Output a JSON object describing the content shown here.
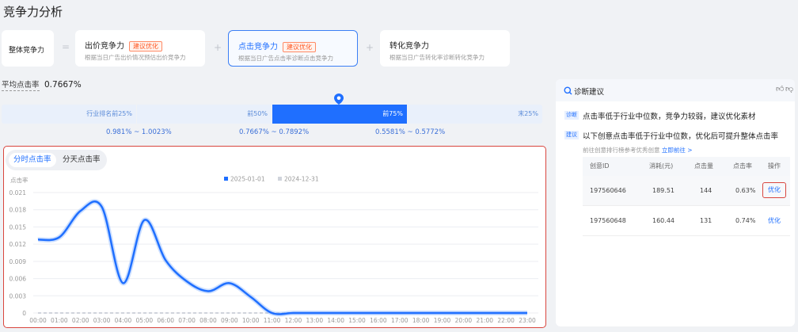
{
  "page_title": "竞争力分析",
  "overall": {
    "label": "整体竞争力"
  },
  "cards": [
    {
      "title": "出价竞争力",
      "tag": "建议优化",
      "desc": "根据当日广告出价情况预估出价竞争力"
    },
    {
      "title": "点击竞争力",
      "tag": "建议优化",
      "desc": "根据当日广告点击率诊断点击竞争力"
    },
    {
      "title": "转化竞争力",
      "tag": "",
      "desc": "根据当日广告转化率诊断转化竞争力"
    }
  ],
  "avg": {
    "label": "平均点击率",
    "value": "0.7667%"
  },
  "percentiles": {
    "segments": [
      "行业排名前25%",
      "前50%",
      "前75%",
      "末25%"
    ],
    "ranges": [
      "0.981% ~ 1.0023%",
      "0.7667% ~ 0.7892%",
      "0.5581% ~ 0.5772%"
    ],
    "active_index": 2
  },
  "chart_tabs": [
    "分时点击率",
    "分天点击率"
  ],
  "chart_data": {
    "type": "line",
    "ylabel": "点击率",
    "ylim": [
      0,
      0.021
    ],
    "yticks": [
      "0",
      "0.003",
      "0.006",
      "0.009",
      "0.012",
      "0.015",
      "0.018",
      "0.021"
    ],
    "categories": [
      "00:00",
      "01:00",
      "02:00",
      "03:00",
      "04:00",
      "05:00",
      "06:00",
      "07:00",
      "08:00",
      "09:00",
      "10:00",
      "11:00",
      "12:00",
      "13:00",
      "14:00",
      "15:00",
      "16:00",
      "17:00",
      "18:00",
      "19:00",
      "20:00",
      "21:00",
      "22:00",
      "23:00"
    ],
    "series": [
      {
        "name": "2025-01-01",
        "color": "#1f6fff",
        "values": [
          0.0128,
          0.0132,
          0.0178,
          0.0185,
          0.0052,
          0.0162,
          0.0092,
          0.0055,
          0.0038,
          0.0052,
          0.0028,
          0,
          0,
          0,
          0,
          0,
          0,
          0,
          0,
          0,
          0,
          0,
          0,
          0
        ]
      },
      {
        "name": "2024-12-31",
        "color": "#d0d4dc",
        "values": [
          0,
          0,
          0,
          0,
          0,
          0,
          0,
          0,
          0,
          0,
          0,
          0,
          0,
          0,
          0,
          0,
          0,
          0,
          0,
          0,
          0,
          0,
          0,
          0
        ]
      }
    ],
    "legend": "top-center",
    "grid": true
  },
  "diagnosis": {
    "title": "诊断建议",
    "diag_tag": "诊断",
    "diag_text": "点击率低于行业中位数，竞争力较弱，建议优化素材",
    "sugg_tag": "建议",
    "sugg_text": "以下创意点击率低于行业中位数，优化后可提升整体点击率",
    "sub_text": "前往创意排行榜参考优秀创意",
    "sub_link": "立即前往 >",
    "table": {
      "headers": [
        "创意ID",
        "消耗(元)",
        "点击量",
        "点击率",
        "操作"
      ],
      "rows": [
        [
          "197560646",
          "189.51",
          "144",
          "0.63%",
          "优化"
        ],
        [
          "197560648",
          "160.44",
          "131",
          "0.74%",
          "优化"
        ]
      ]
    }
  }
}
